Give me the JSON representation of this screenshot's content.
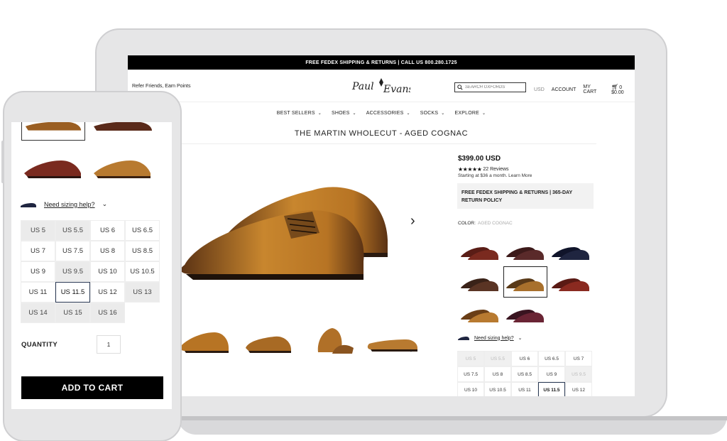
{
  "desktop": {
    "promo_bar": "FREE FEDEX SHIPPING & RETURNS  |  CALL US 800.280.1725",
    "refer_link": "Refer Friends, Earn Points",
    "logo_text": "Paul Evans",
    "search": {
      "placeholder": "SEARCH OXFORDS"
    },
    "header": {
      "currency": "USD",
      "account": "ACCOUNT",
      "my_cart": "MY CART",
      "cart_count": "0",
      "cart_total": "$0.00"
    },
    "nav": [
      {
        "label": "BEST SELLERS"
      },
      {
        "label": "SHOES"
      },
      {
        "label": "ACCESSORIES"
      },
      {
        "label": "SOCKS"
      },
      {
        "label": "EXPLORE"
      }
    ],
    "product": {
      "title": "THE MARTIN WHOLECUT - AGED COGNAC",
      "price": "$399.00 USD",
      "rating_stars": 5,
      "reviews": "22 Reviews",
      "financing": "Starting at $36 a month. Learn More",
      "shipping_line1": "FREE FEDEX SHIPPING & RETURNS | 365-DAY",
      "shipping_line2": "RETURN POLICY",
      "color_label": "COLOR:",
      "color_selected": "AGED COGNAC",
      "sizing_help": "Need sizing help?"
    },
    "swatches": [
      {
        "color": "#7a2a1f",
        "accent": "#5a1d16",
        "selected": false
      },
      {
        "color": "#5a2a2a",
        "accent": "#3d1a1a",
        "selected": false
      },
      {
        "color": "#1f2540",
        "accent": "#10142a",
        "selected": false
      },
      {
        "color": "#5a3424",
        "accent": "#3a2218",
        "selected": false
      },
      {
        "color": "#a8702c",
        "accent": "#5a3a18",
        "selected": true
      },
      {
        "color": "#8a2a20",
        "accent": "#5a1a14",
        "selected": false
      },
      {
        "color": "#b87a30",
        "accent": "#6a3e16",
        "selected": false
      },
      {
        "color": "#6a2434",
        "accent": "#3a1420",
        "selected": false
      }
    ],
    "sizes": [
      {
        "label": "US 5",
        "state": "oos"
      },
      {
        "label": "US 5.5",
        "state": "oos"
      },
      {
        "label": "US 6",
        "state": "normal"
      },
      {
        "label": "US 6.5",
        "state": "normal"
      },
      {
        "label": "US 7",
        "state": "normal"
      },
      {
        "label": "US 7.5",
        "state": "normal"
      },
      {
        "label": "US 8",
        "state": "normal"
      },
      {
        "label": "US 8.5",
        "state": "normal"
      },
      {
        "label": "US 9",
        "state": "normal"
      },
      {
        "label": "US 9.5",
        "state": "oos"
      },
      {
        "label": "US 10",
        "state": "normal"
      },
      {
        "label": "US 10.5",
        "state": "normal"
      },
      {
        "label": "US 11",
        "state": "normal"
      },
      {
        "label": "US 11.5",
        "state": "active"
      },
      {
        "label": "US 12",
        "state": "normal"
      }
    ]
  },
  "mobile": {
    "sizing_help": "Need sizing help?",
    "sizes": [
      {
        "label": "US 5",
        "state": "oos"
      },
      {
        "label": "US 5.5",
        "state": "oos"
      },
      {
        "label": "US 6",
        "state": "normal"
      },
      {
        "label": "US 6.5",
        "state": "normal"
      },
      {
        "label": "US 7",
        "state": "normal"
      },
      {
        "label": "US 7.5",
        "state": "normal"
      },
      {
        "label": "US 8",
        "state": "normal"
      },
      {
        "label": "US 8.5",
        "state": "normal"
      },
      {
        "label": "US 9",
        "state": "normal"
      },
      {
        "label": "US 9.5",
        "state": "oos"
      },
      {
        "label": "US 10",
        "state": "normal"
      },
      {
        "label": "US 10.5",
        "state": "normal"
      },
      {
        "label": "US 11",
        "state": "normal"
      },
      {
        "label": "US 11.5",
        "state": "active"
      },
      {
        "label": "US 12",
        "state": "normal"
      },
      {
        "label": "US 13",
        "state": "oos"
      },
      {
        "label": "US 14",
        "state": "oos"
      },
      {
        "label": "US 15",
        "state": "oos"
      },
      {
        "label": "US 16",
        "state": "oos"
      }
    ],
    "quantity_label": "QUANTITY",
    "quantity_value": "1",
    "add_to_cart": "ADD TO CART"
  },
  "colors": {
    "cognac_light": "#c8862e",
    "cognac_dark": "#5a3214",
    "selected_border": "#2b3a55"
  }
}
